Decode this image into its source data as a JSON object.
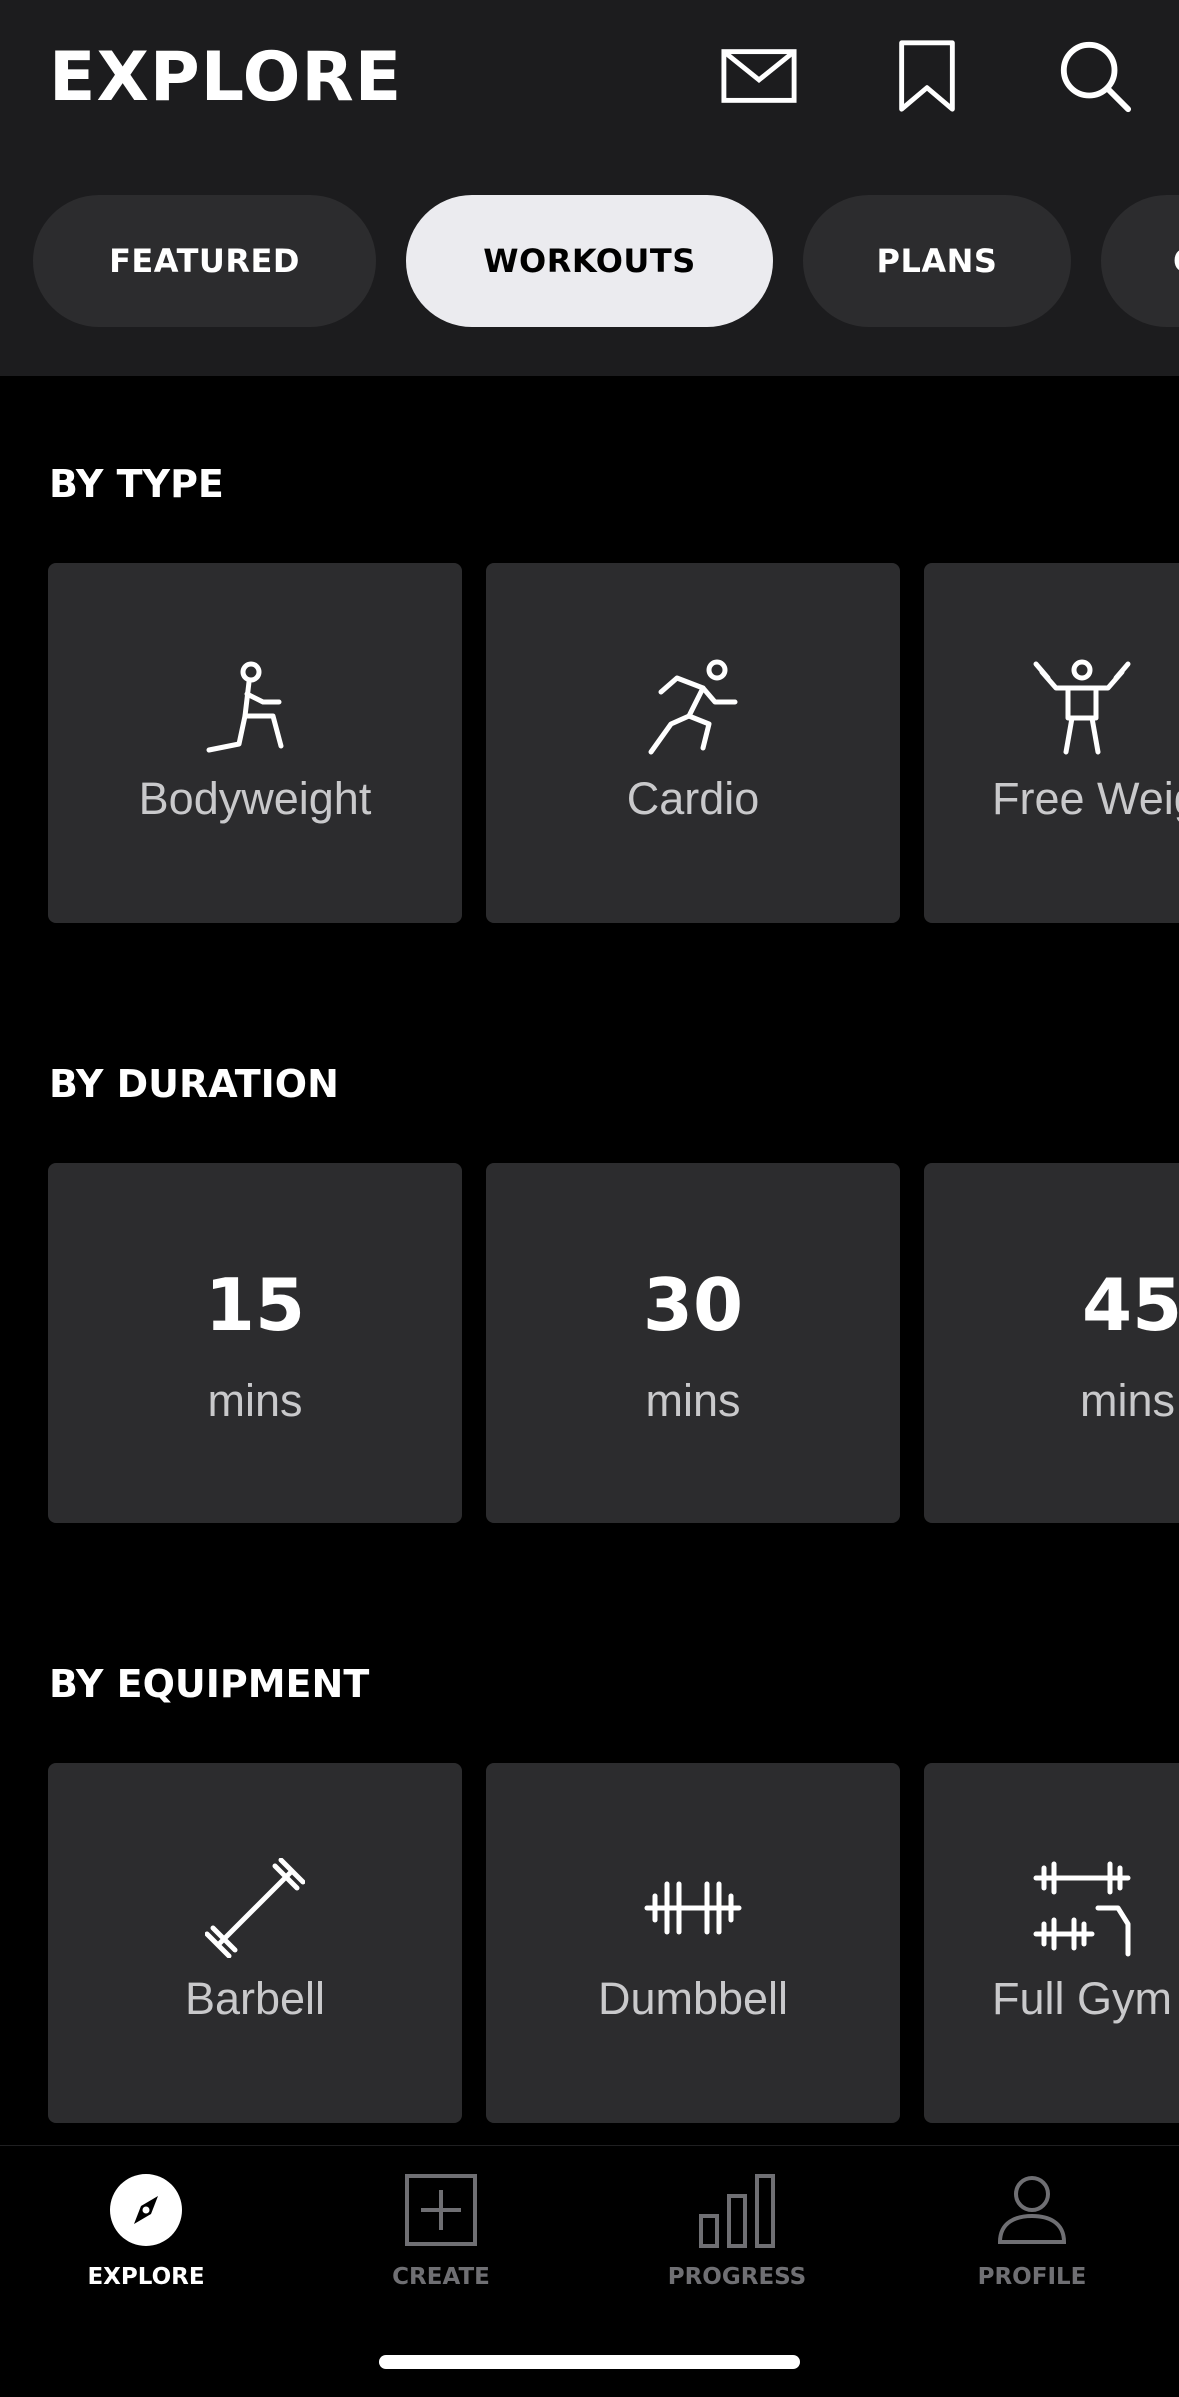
{
  "header": {
    "title": "EXPLORE",
    "icons": [
      "mail-icon",
      "bookmark-icon",
      "search-icon"
    ]
  },
  "tabs": [
    {
      "label": "FEATURED",
      "active": false
    },
    {
      "label": "WORKOUTS",
      "active": true
    },
    {
      "label": "PLANS",
      "active": false
    },
    {
      "label": "C",
      "active": false
    }
  ],
  "sections": {
    "by_type": {
      "title": "BY TYPE",
      "cards": [
        {
          "label": "Bodyweight",
          "icon": "bodyweight-icon"
        },
        {
          "label": "Cardio",
          "icon": "cardio-icon"
        },
        {
          "label": "Free Weights",
          "icon": "free-weights-icon"
        }
      ]
    },
    "by_duration": {
      "title": "BY DURATION",
      "cards": [
        {
          "value": "15",
          "unit": "mins"
        },
        {
          "value": "30",
          "unit": "mins"
        },
        {
          "value": "45",
          "unit": "mins"
        }
      ]
    },
    "by_equipment": {
      "title": "BY EQUIPMENT",
      "cards": [
        {
          "label": "Barbell",
          "icon": "barbell-icon"
        },
        {
          "label": "Dumbbell",
          "icon": "dumbbell-icon"
        },
        {
          "label": "Full Gym",
          "icon": "full-gym-icon"
        }
      ]
    }
  },
  "bottom_nav": [
    {
      "label": "EXPLORE",
      "icon": "compass-icon",
      "active": true
    },
    {
      "label": "CREATE",
      "icon": "plus-square-icon",
      "active": false
    },
    {
      "label": "PROGRESS",
      "icon": "bar-chart-icon",
      "active": false
    },
    {
      "label": "PROFILE",
      "icon": "person-icon",
      "active": false
    }
  ],
  "colors": {
    "background": "#000000",
    "header": "#1c1c1e",
    "card": "#2c2c2e",
    "active_tab": "#ebebef",
    "inactive_nav": "#6f6f73"
  }
}
